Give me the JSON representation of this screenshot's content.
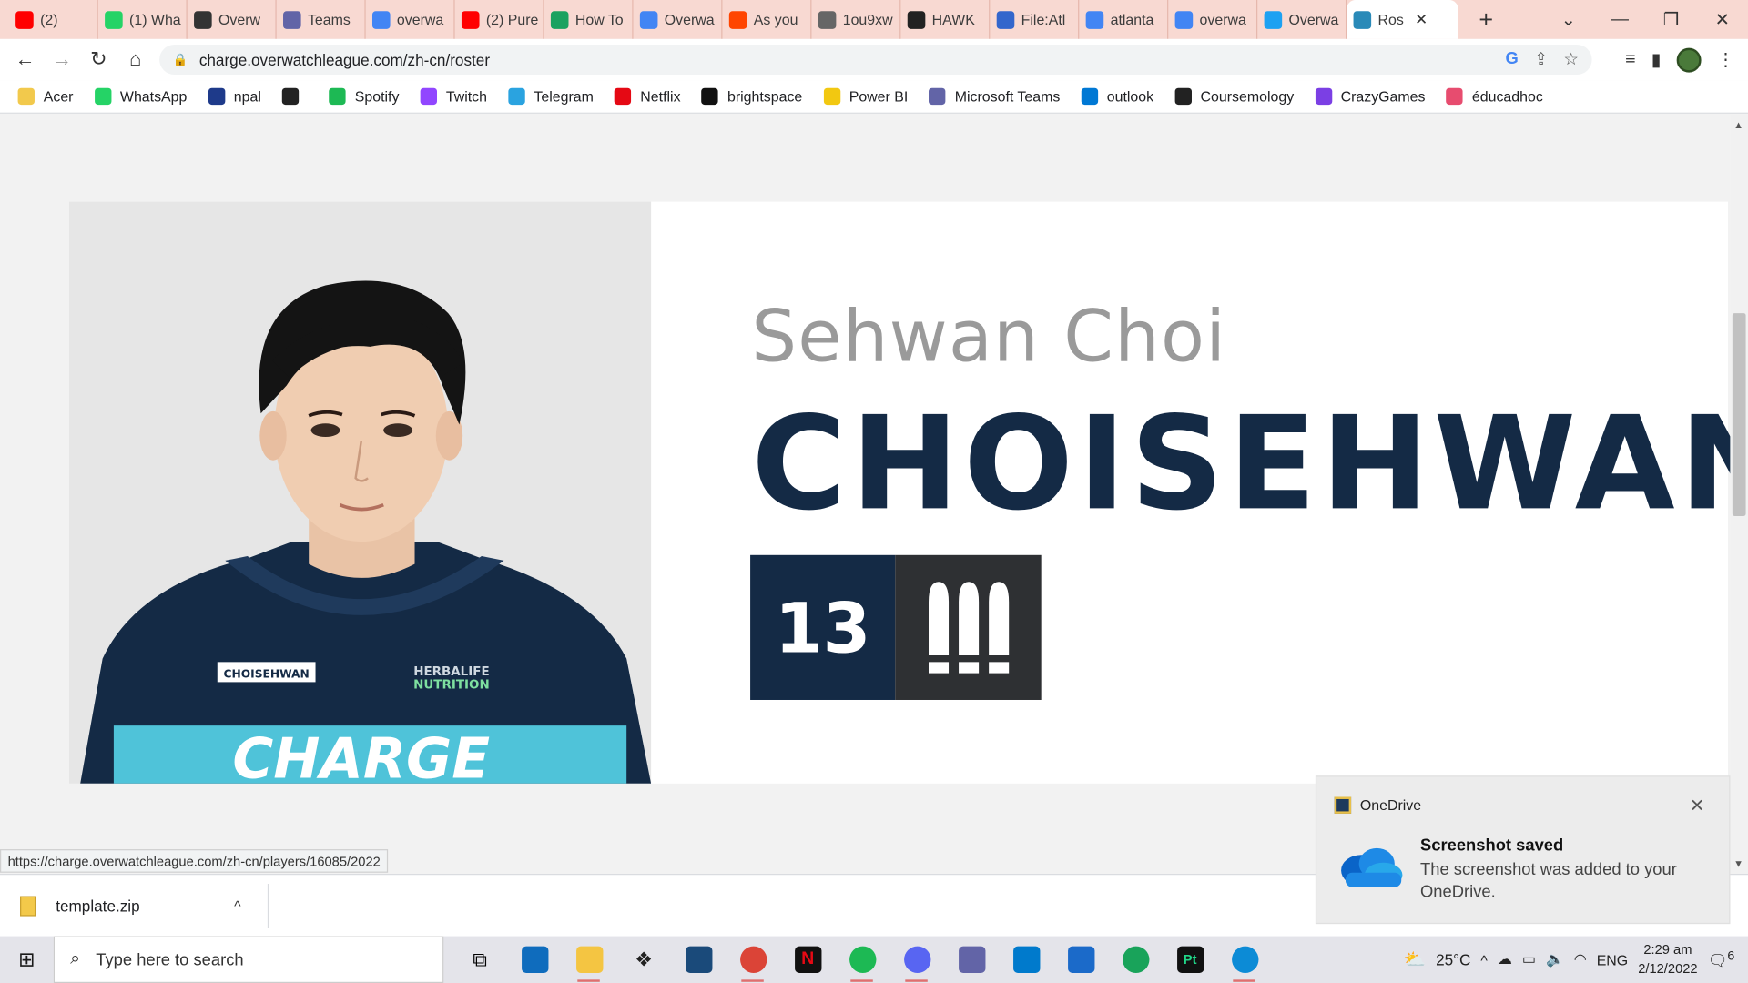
{
  "browser": {
    "tabs": [
      {
        "label": "(2)",
        "color": "#ff0000"
      },
      {
        "label": "(1) Wha",
        "color": "#25d366"
      },
      {
        "label": "Overw",
        "color": "#333333"
      },
      {
        "label": "Teams",
        "color": "#6264a7"
      },
      {
        "label": "overwa",
        "color": "#4285f4"
      },
      {
        "label": "(2) Pure",
        "color": "#ff0000"
      },
      {
        "label": "How To",
        "color": "#1aa260"
      },
      {
        "label": "Overwa",
        "color": "#4285f4"
      },
      {
        "label": "As you",
        "color": "#ff4500"
      },
      {
        "label": "1ou9xw",
        "color": "#666666"
      },
      {
        "label": "HAWK",
        "color": "#222222"
      },
      {
        "label": "File:Atl",
        "color": "#3366cc"
      },
      {
        "label": "atlanta",
        "color": "#4285f4"
      },
      {
        "label": "overwa",
        "color": "#4285f4"
      },
      {
        "label": "Overwa",
        "color": "#1da1f2"
      }
    ],
    "active_tab": {
      "label": "Ros",
      "color": "#2a8ab8"
    },
    "url": "charge.overwatchleague.com/zh-cn/roster",
    "bookmarks": [
      {
        "label": "Acer",
        "color": "#f2c94c"
      },
      {
        "label": "WhatsApp",
        "color": "#25d366"
      },
      {
        "label": "npal",
        "color": "#1e3a8a"
      },
      {
        "label": "",
        "color": "#222222"
      },
      {
        "label": "Spotify",
        "color": "#1db954"
      },
      {
        "label": "Twitch",
        "color": "#9146ff"
      },
      {
        "label": "Telegram",
        "color": "#2aa3e0"
      },
      {
        "label": "Netflix",
        "color": "#e50914"
      },
      {
        "label": "brightspace",
        "color": "#111111"
      },
      {
        "label": "Power BI",
        "color": "#f2c811"
      },
      {
        "label": "Microsoft Teams",
        "color": "#6264a7"
      },
      {
        "label": "outlook",
        "color": "#0078d4"
      },
      {
        "label": "Coursemology",
        "color": "#222222"
      },
      {
        "label": "CrazyGames",
        "color": "#7b3fe4"
      },
      {
        "label": "éducadhoc",
        "color": "#e74c6f"
      }
    ]
  },
  "player": {
    "real_name": "Sehwan Choi",
    "handle": "CHOISEHWAN",
    "number": "13",
    "role_icon": "damage-icon",
    "jersey_name": "CHOISEHWAN",
    "jersey_sponsor": "HERBALIFE NUTRITION",
    "jersey_team": "CHARGE"
  },
  "status_url": "https://charge.overwatchleague.com/zh-cn/players/16085/2022",
  "downloads": {
    "file": "template.zip"
  },
  "toast": {
    "app": "OneDrive",
    "title": "Screenshot saved",
    "message": "The screenshot was added to your OneDrive."
  },
  "taskbar": {
    "search_placeholder": "Type here to search",
    "weather": "25°C",
    "lang": "ENG",
    "time": "2:29 am",
    "date": "2/12/2022",
    "notifications": "6"
  }
}
